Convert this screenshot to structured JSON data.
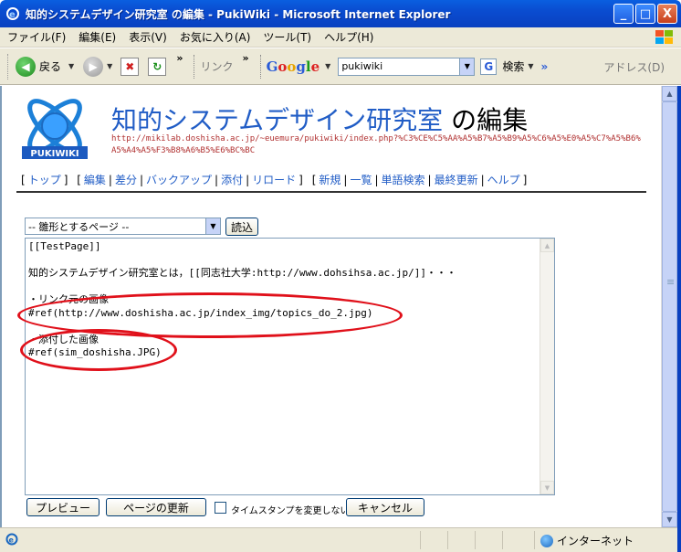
{
  "window": {
    "title": "知的システムデザイン研究室 の編集 - PukiWiki - Microsoft Internet Explorer",
    "buttons": [
      "_",
      "□",
      "X"
    ]
  },
  "menu": [
    "ファイル(F)",
    "編集(E)",
    "表示(V)",
    "お気に入り(A)",
    "ツール(T)",
    "ヘルプ(H)"
  ],
  "toolbar": {
    "back_label": "戻る",
    "links_label": "リンク",
    "google_search_value": "pukiwiki",
    "search_label": "検索",
    "address_label": "アドレス(D)",
    "chevron": "»",
    "more": "»"
  },
  "page": {
    "title_main": "知的システムデザイン研究室",
    "title_suffix": " の編集",
    "url": "http://mikilab.doshisha.ac.jp/~euemura/pukiwiki/index.php?%C3%CE%C5%AA%A5%B7%A5%B9%A5%C6%A5%E0%A5%C7%A5%B6%A5%A4%A5%F3%B8%A6%B5%E6%BC%BC",
    "logo_text": "PUKIWIKI",
    "nav": {
      "top": "トップ",
      "edit": "編集",
      "diff": "差分",
      "backup": "バックアップ",
      "attach": "添付",
      "reload": "リロード",
      "new": "新規",
      "list": "一覧",
      "search": "単語検索",
      "recent": "最終更新",
      "help": "ヘルプ"
    }
  },
  "form": {
    "template_select": "-- 雛形とするページ --",
    "read_button": "読込",
    "editor_text": "[[TestPage]]\n\n知的システムデザイン研究室とは，[[同志社大学:http://www.dohsihsa.ac.jp/]]・・・\n\n・リンク元の画像\n#ref(http://www.doshisha.ac.jp/index_img/topics_do_2.jpg)\n\n・添付した画像\n#ref(sim_doshisha.JPG)",
    "preview_button": "プレビュー",
    "update_button": "ページの更新",
    "timestamp_label": "タイムスタンプを変更しない",
    "cancel_button": "キャンセル"
  },
  "status": {
    "zone": "インターネット"
  },
  "colors": {
    "link": "#215dc6",
    "highlight": "#e0101a",
    "titlebar": "#0a4cd0"
  }
}
